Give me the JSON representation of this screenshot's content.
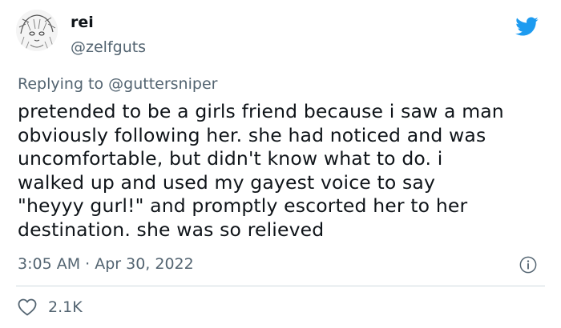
{
  "author": {
    "name": "rei",
    "handle": "@zelfguts"
  },
  "reply": {
    "prefix": "Replying to ",
    "mention": "@guttersniper"
  },
  "tweet": {
    "lines": [
      "pretended to be a girls friend because i saw a man",
      "obviously following her. she had noticed and was",
      "uncomfortable, but didn't know what to do. i",
      "walked up and used my gayest voice to say",
      "\"heyyy gurl!\" and promptly escorted her to her",
      "destination. she was so relieved"
    ],
    "timestamp": "3:05 AM · Apr 30, 2022"
  },
  "engagement": {
    "likes": "2.1K"
  },
  "icons": {
    "platform": "twitter-bird-icon",
    "info": "info-icon",
    "like": "heart-icon"
  },
  "colors": {
    "brand": "#1d9bf0",
    "text": "#0f1419",
    "secondary": "#536471",
    "divider": "#cfd9de"
  }
}
